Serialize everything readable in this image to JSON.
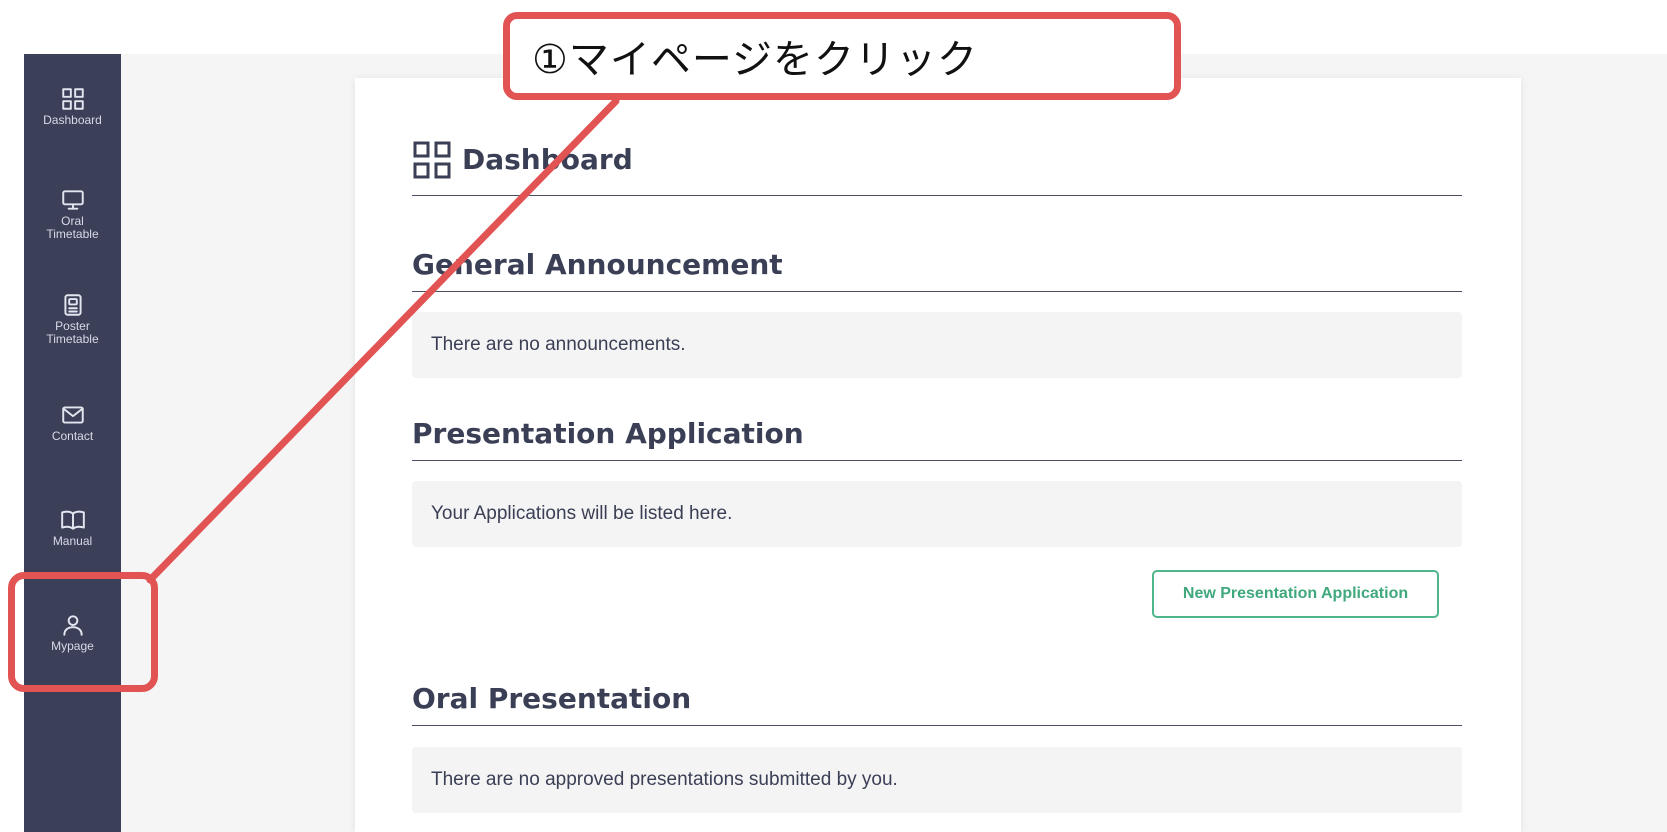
{
  "sidebar": {
    "items": [
      {
        "label": "Dashboard",
        "icon": "grid-icon"
      },
      {
        "label": "Oral\nTimetable",
        "icon": "monitor-icon"
      },
      {
        "label": "Poster\nTimetable",
        "icon": "poster-icon"
      },
      {
        "label": "Contact",
        "icon": "envelope-icon"
      },
      {
        "label": "Manual",
        "icon": "book-icon"
      },
      {
        "label": "Mypage",
        "icon": "user-icon"
      }
    ]
  },
  "main": {
    "title": "Dashboard",
    "sections": [
      {
        "title": "General Announcement",
        "message": "There are no announcements."
      },
      {
        "title": "Presentation Application",
        "message": "Your Applications will be listed here.",
        "button": "New Presentation Application"
      },
      {
        "title": "Oral Presentation",
        "message": "There are no approved presentations submitted by you."
      }
    ]
  },
  "annotation": {
    "text": "①マイページをクリック",
    "color": "#e25454"
  },
  "colors": {
    "sidebar": "#3b3f58",
    "accent": "#4fb58b",
    "text": "#3a3f55"
  }
}
